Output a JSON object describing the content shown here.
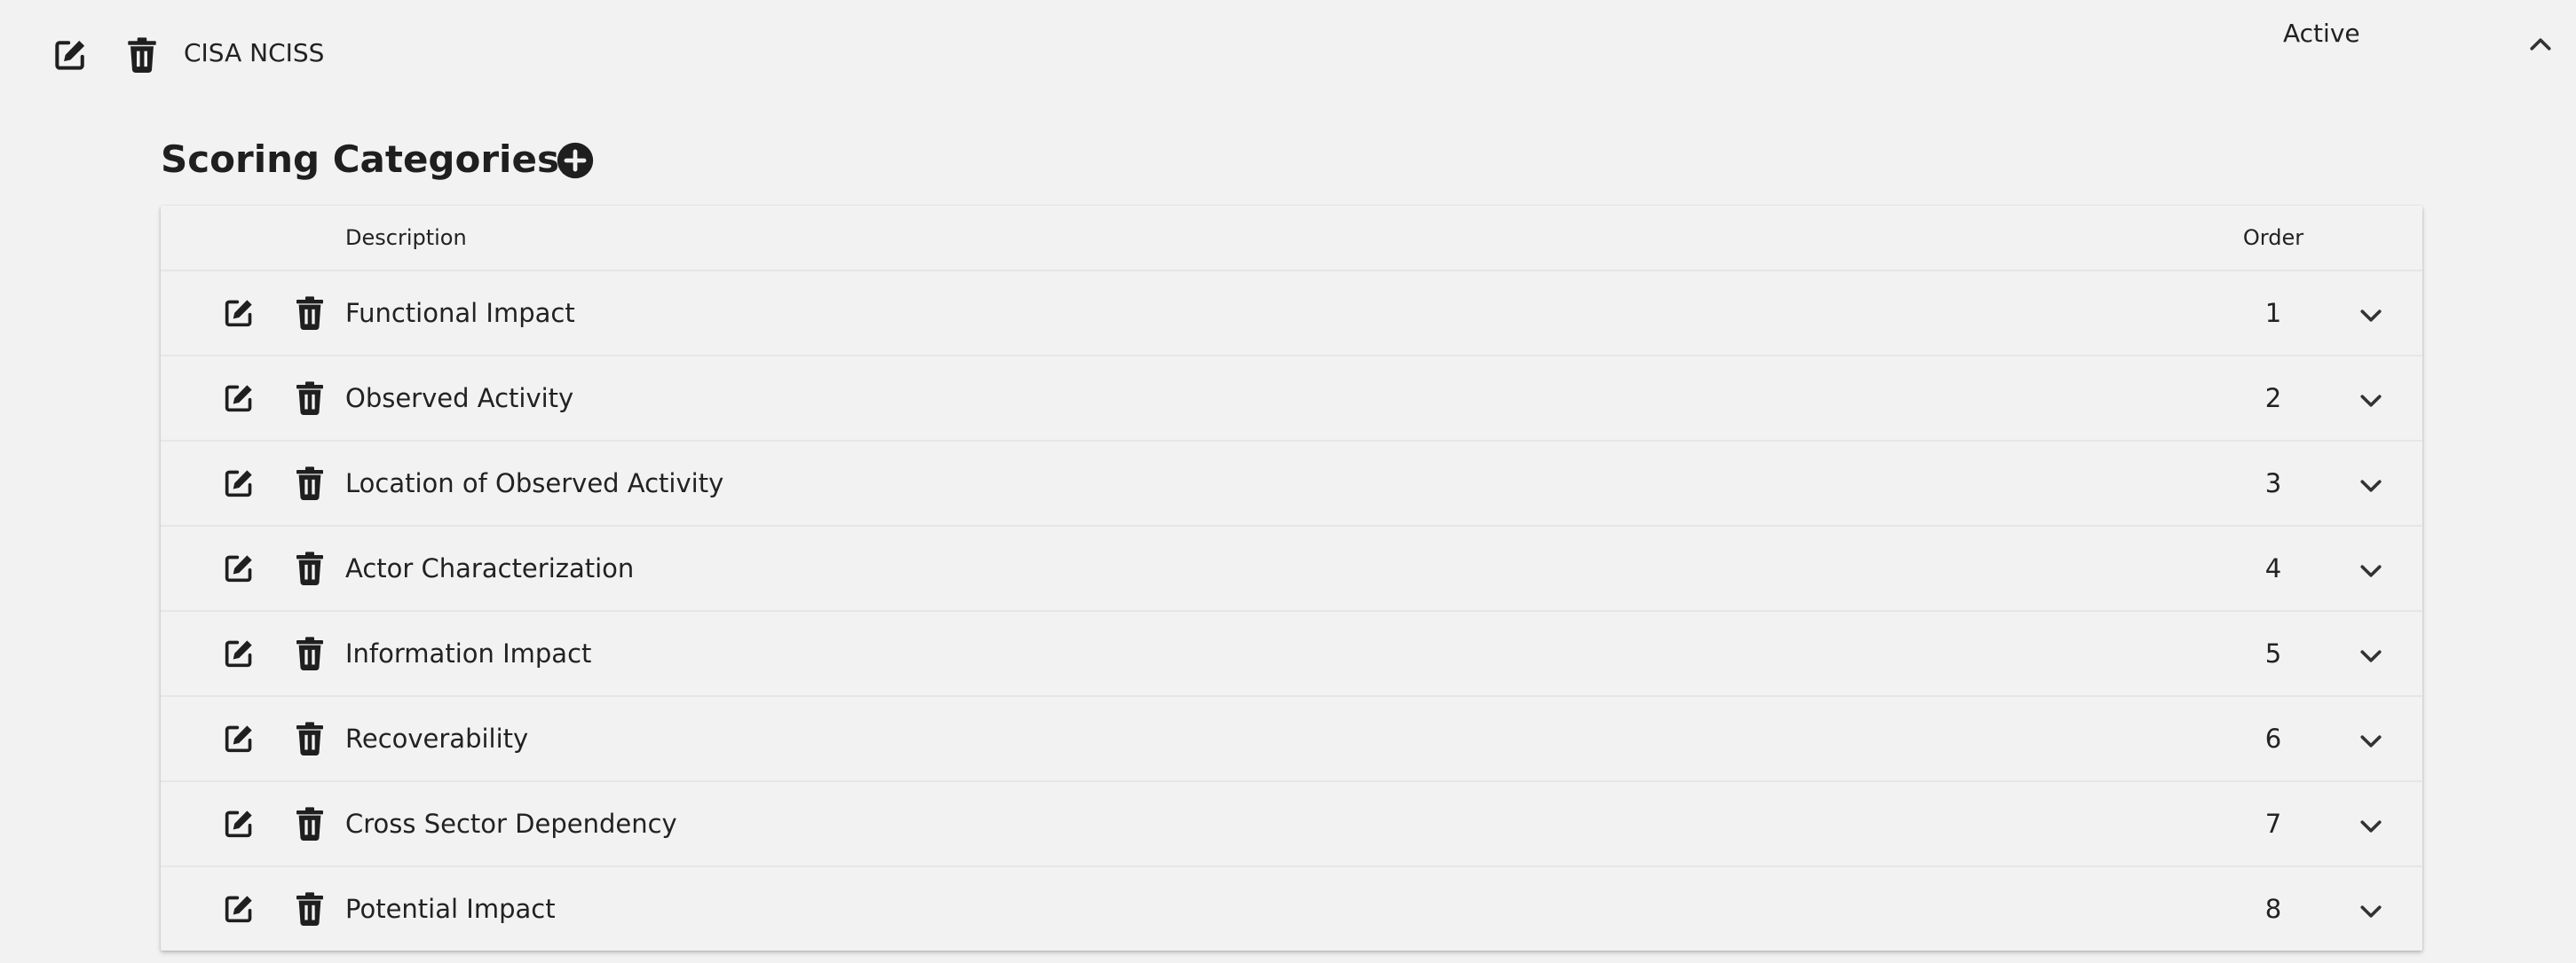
{
  "header": {
    "item_name": "CISA NCISS",
    "status": "Active"
  },
  "section": {
    "title": "Scoring Categories"
  },
  "table": {
    "columns": {
      "description": "Description",
      "order": "Order"
    },
    "rows": [
      {
        "description": "Functional Impact",
        "order": "1"
      },
      {
        "description": "Observed Activity",
        "order": "2"
      },
      {
        "description": "Location of Observed Activity",
        "order": "3"
      },
      {
        "description": "Actor Characterization",
        "order": "4"
      },
      {
        "description": "Information Impact",
        "order": "5"
      },
      {
        "description": "Recoverability",
        "order": "6"
      },
      {
        "description": "Cross Sector Dependency",
        "order": "7"
      },
      {
        "description": "Potential Impact",
        "order": "8"
      }
    ]
  },
  "icons": {
    "edit": "edit-icon",
    "delete": "trash-icon",
    "add": "plus-circle-icon",
    "expand": "chevron-down-icon",
    "collapse": "chevron-up-icon"
  },
  "colors": {
    "background": "#f2f2f2",
    "icon": "#1f1f1f",
    "text": "#222222",
    "divider": "#e6e6e6"
  }
}
